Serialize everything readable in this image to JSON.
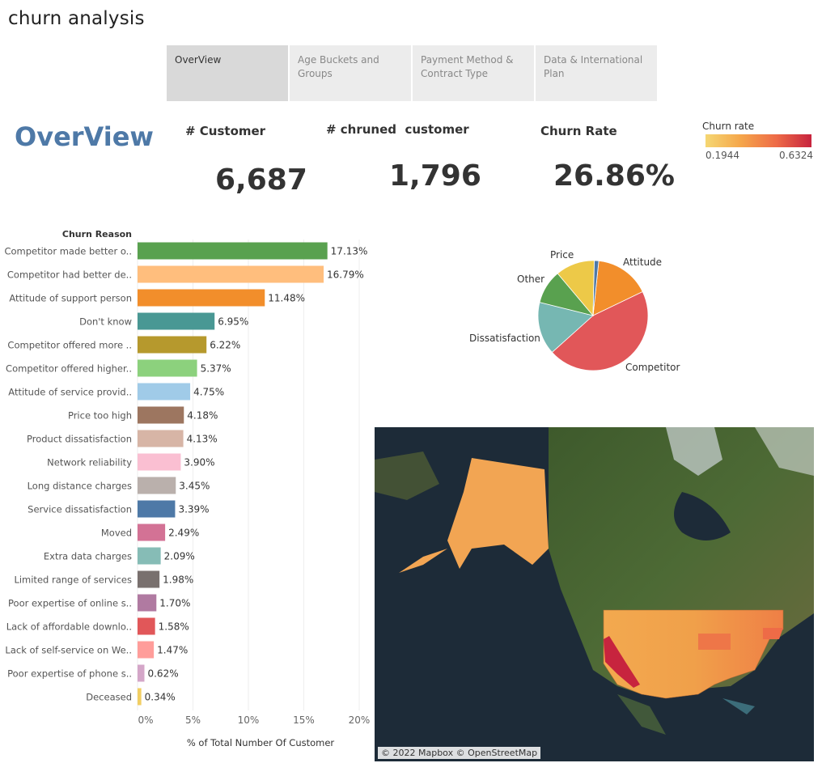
{
  "app": {
    "title": "churn analysis"
  },
  "tabs": [
    {
      "label": "OverView",
      "active": true
    },
    {
      "label": "Age Buckets and Groups",
      "active": false
    },
    {
      "label": "Payment Method & Contract Type",
      "active": false
    },
    {
      "label": "Data & International Plan",
      "active": false
    }
  ],
  "section_title": "OverView",
  "kpis": [
    {
      "label": "# Customer",
      "value": "6,687"
    },
    {
      "label": "# chruned  customer",
      "value": "1,796"
    },
    {
      "label": "Churn Rate",
      "value": "26.86%"
    }
  ],
  "legend": {
    "title": "Churn rate",
    "min": "0.1944",
    "max": "0.6324",
    "colors": [
      "#f5d773",
      "#f5a64a",
      "#ee6b47",
      "#c7243e"
    ]
  },
  "map": {
    "credit": "© 2022 Mapbox © OpenStreetMap"
  },
  "chart_data": [
    {
      "type": "bar",
      "orientation": "horizontal",
      "header": "Churn Reason",
      "xlabel": "% of Total Number Of Customer",
      "xlim": [
        0,
        20
      ],
      "xticks": [
        "0%",
        "5%",
        "10%",
        "15%",
        "20%"
      ],
      "categories": [
        "Competitor made better o..",
        "Competitor had better de..",
        "Attitude of support person",
        "Don't know",
        "Competitor offered more ..",
        "Competitor offered higher..",
        "Attitude of service provid..",
        "Price too high",
        "Product dissatisfaction",
        "Network reliability",
        "Long distance charges",
        "Service dissatisfaction",
        "Moved",
        "Extra data charges",
        "Limited range of services",
        "Poor expertise of online s..",
        "Lack of affordable downlo..",
        "Lack of self-service on We..",
        "Poor expertise of phone s..",
        "Deceased"
      ],
      "values": [
        17.13,
        16.79,
        11.48,
        6.95,
        6.22,
        5.37,
        4.75,
        4.18,
        4.13,
        3.9,
        3.45,
        3.39,
        2.49,
        2.09,
        1.98,
        1.7,
        1.58,
        1.47,
        0.62,
        0.34
      ],
      "labels": [
        "17.13%",
        "16.79%",
        "11.48%",
        "6.95%",
        "6.22%",
        "5.37%",
        "4.75%",
        "4.18%",
        "4.13%",
        "3.90%",
        "3.45%",
        "3.39%",
        "2.49%",
        "2.09%",
        "1.98%",
        "1.70%",
        "1.58%",
        "1.47%",
        "0.62%",
        "0.34%"
      ],
      "colors": [
        "#59a14f",
        "#ffbe7d",
        "#f28e2b",
        "#499894",
        "#b6992d",
        "#8cd17d",
        "#a0cbe8",
        "#9d7660",
        "#d7b5a6",
        "#fabfd2",
        "#bab0ac",
        "#4e79a7",
        "#d37295",
        "#86bcb6",
        "#79706e",
        "#b07aa1",
        "#e15759",
        "#ff9d9a",
        "#d4a6c8",
        "#f1ce63"
      ]
    },
    {
      "type": "pie",
      "categories": [
        "Attitude",
        "Competitor",
        "Dissatisfaction",
        "Other",
        "Price",
        "Don't know"
      ],
      "values": [
        16.2,
        45.5,
        15.5,
        10.0,
        11.5,
        1.3
      ],
      "labels": [
        "Attitude",
        "Competitor",
        "Dissatisfaction",
        "Other",
        "Price",
        ""
      ],
      "colors": [
        "#f28e2b",
        "#e15759",
        "#76b7b2",
        "#59a14f",
        "#edc948",
        "#4e79a7"
      ]
    }
  ]
}
